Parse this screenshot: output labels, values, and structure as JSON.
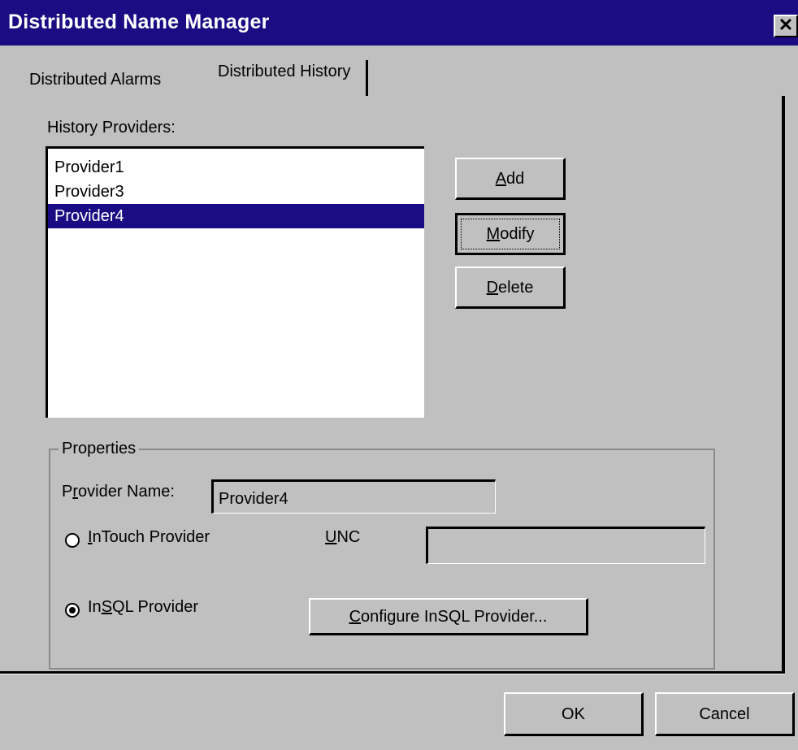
{
  "window": {
    "title": "Distributed Name Manager",
    "close_glyph": "✕",
    "close_icon": "close-icon"
  },
  "tabs": [
    {
      "label": "Distributed Alarms",
      "active": false
    },
    {
      "label": "Distributed History",
      "active": true
    }
  ],
  "history_providers": {
    "label": "History Providers:",
    "items": [
      "Provider1",
      "Provider3",
      "Provider4"
    ],
    "selected": "Provider4"
  },
  "list_buttons": {
    "add": {
      "mnemonic": "A",
      "rest": "dd"
    },
    "modify": {
      "mnemonic": "M",
      "rest": "odify"
    },
    "delete": {
      "mnemonic": "D",
      "rest": "elete"
    }
  },
  "properties": {
    "caption": "Properties",
    "provider_name_label": {
      "pre": "P",
      "mnemonic": "r",
      "rest": "ovider Name:"
    },
    "provider_name_value": "Provider4",
    "intouch_radio": {
      "mnemonic": "I",
      "rest": "nTouch Provider",
      "checked": false
    },
    "unc_label": {
      "mnemonic": "U",
      "rest": "NC"
    },
    "unc_value": "",
    "insql_radio": {
      "pre": "In",
      "mnemonic": "S",
      "rest": "QL Provider",
      "checked": true
    },
    "configure_button": {
      "mnemonic": "C",
      "rest": "onfigure InSQL Provider..."
    }
  },
  "footer": {
    "ok_label": "OK",
    "cancel_label": "Cancel"
  },
  "colors": {
    "selection": "#1c0c83",
    "titlebar": "#1c0c83",
    "face": "#c0c0c0"
  }
}
